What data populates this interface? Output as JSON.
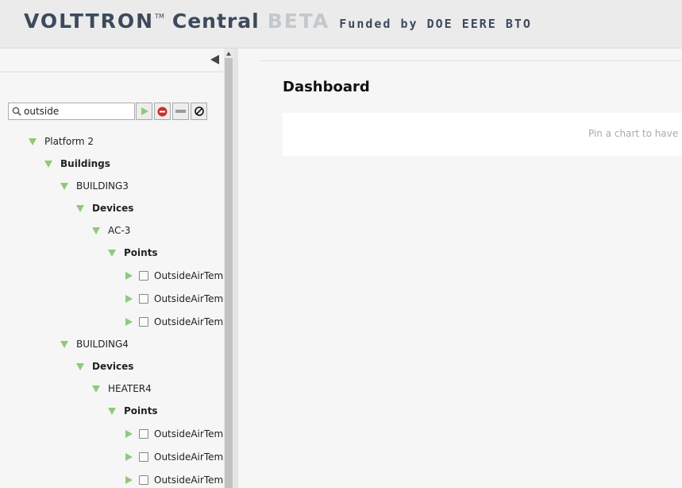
{
  "header": {
    "logo_main": "VOLTTRON",
    "logo_tm": "TM",
    "logo_central": "Central",
    "logo_beta": "BETA",
    "logo_funded": "Funded by DOE EERE BTO"
  },
  "filter": {
    "value": "outside",
    "placeholder": ""
  },
  "icons": {
    "filter": "search-icon",
    "play": "play-icon",
    "remove": "remove-icon",
    "clear": "minus-icon",
    "cancel": "cancel-icon",
    "collapse": "collapse-left-icon"
  },
  "colors": {
    "tree_arrow": "#8fc97a",
    "remove_button": "#c9302c",
    "header_text": "#3d4a5c",
    "beta_text": "#c4c8cc"
  },
  "tree": {
    "platform": "Platform 2",
    "buildings": "Buildings",
    "building3": {
      "name": "BUILDING3",
      "devices": "Devices",
      "device": "AC-3",
      "points": "Points",
      "items": [
        "OutsideAirTemp",
        "OutsideAirTemp",
        "OutsideAirTemp"
      ]
    },
    "building4": {
      "name": "BUILDING4",
      "devices": "Devices",
      "device": "HEATER4",
      "points": "Points",
      "items": [
        "OutsideAirTemp",
        "OutsideAirTemp",
        "OutsideAirTemp"
      ]
    }
  },
  "main": {
    "title": "Dashboard",
    "pin_message": "Pin a chart to have it"
  }
}
